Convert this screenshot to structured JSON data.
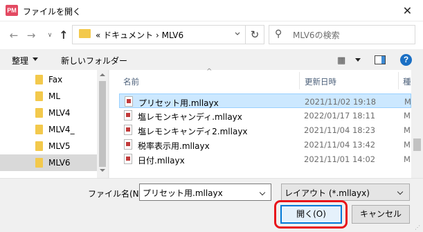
{
  "window": {
    "app_icon_text": "PM",
    "title": "ファイルを開く",
    "close_glyph": "✕"
  },
  "nav": {
    "back": "←",
    "forward": "→",
    "recent": "∨",
    "up": "↑",
    "address": "«  ドキュメント  ›  MLV6",
    "refresh": "↻",
    "search_icon": "⚲",
    "search_placeholder": "MLV6の検索"
  },
  "toolbar": {
    "organize_label": "整理",
    "new_folder_label": "新しいフォルダー",
    "view_icon": "▦",
    "help_icon": "?"
  },
  "sidebar": {
    "items": [
      {
        "label": "Fax",
        "selected": false
      },
      {
        "label": "ML",
        "selected": false
      },
      {
        "label": "MLV4",
        "selected": false
      },
      {
        "label": "MLV4_",
        "selected": false
      },
      {
        "label": "MLV5",
        "selected": false
      },
      {
        "label": "MLV6",
        "selected": true
      }
    ]
  },
  "filelist": {
    "columns": {
      "name": "名前",
      "date": "更新日時",
      "type": "種"
    },
    "rows": [
      {
        "name": "プリセット用.mllayx",
        "date": "2021/11/02 19:18",
        "type": "M",
        "selected": true
      },
      {
        "name": "塩レモンキャンディ.mllayx",
        "date": "2022/01/17 18:11",
        "type": "M",
        "selected": false
      },
      {
        "name": "塩レモンキャンディ2.mllayx",
        "date": "2021/11/04 18:23",
        "type": "M",
        "selected": false
      },
      {
        "name": "税率表示用.mllayx",
        "date": "2021/11/04 13:42",
        "type": "M",
        "selected": false
      },
      {
        "name": "日付.mllayx",
        "date": "2021/11/01 14:02",
        "type": "M",
        "selected": false
      }
    ]
  },
  "footer": {
    "filename_label": "ファイル名(N):",
    "filename_value": "プリセット用.mllayx",
    "filter_value": "レイアウト (*.mllayx)",
    "open_label": "開く(O)",
    "cancel_label": "キャンセル",
    "highlight_color": "#e8141a"
  }
}
